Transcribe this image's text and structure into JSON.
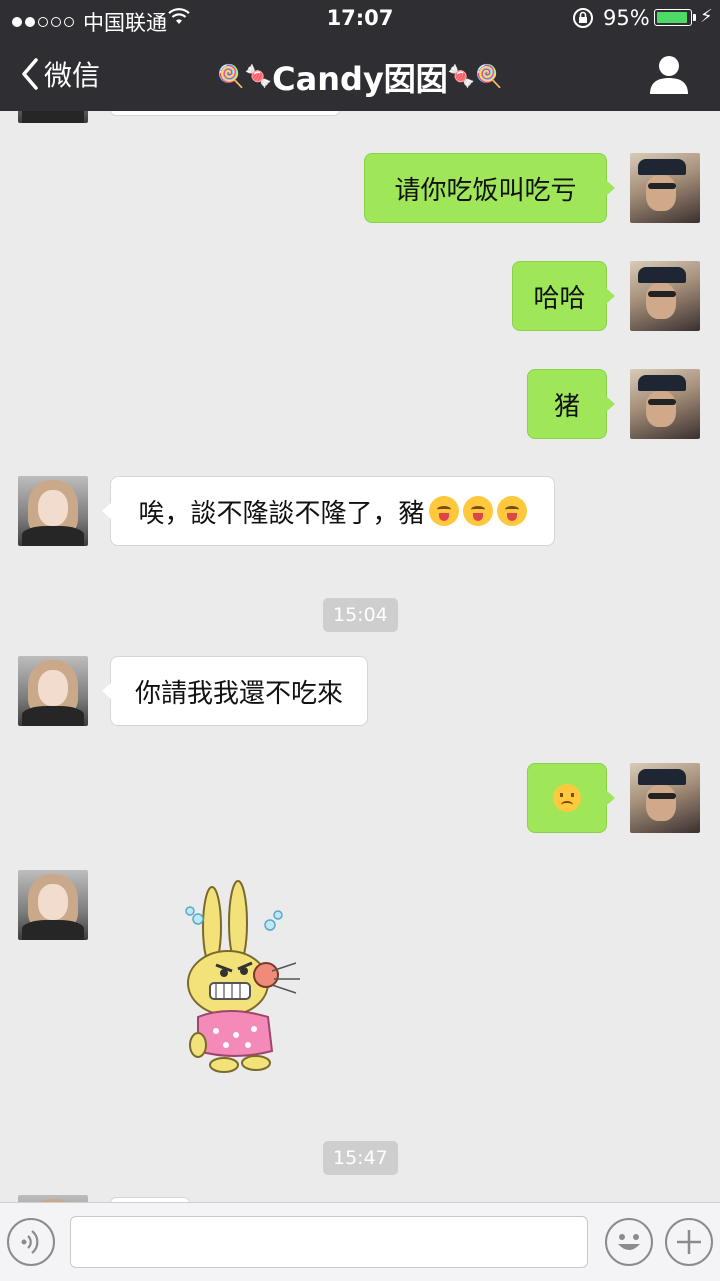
{
  "status_bar": {
    "carrier": "中国联通",
    "time": "17:07",
    "battery_percent": "95%",
    "battery_level": 0.95
  },
  "nav": {
    "back_label": "微信",
    "title": "Candy囡囡",
    "title_deco_left": "🍭🍬",
    "title_deco_right": "🍬🍭"
  },
  "messages": [
    {
      "from": "me",
      "text": "请你吃饭叫吃亏"
    },
    {
      "from": "me",
      "text": "哈哈"
    },
    {
      "from": "me",
      "text": "猪"
    },
    {
      "from": "other",
      "text": "唉，談不隆談不隆了，豬",
      "emoji": "tongue-out-emoji"
    },
    {
      "type": "timestamp",
      "text": "15:04"
    },
    {
      "from": "other",
      "text": "你請我我還不吃來"
    },
    {
      "from": "me",
      "emoji": "frown-emoji"
    },
    {
      "from": "other",
      "sticker": "angry-rabbit-sticker"
    },
    {
      "type": "timestamp",
      "text": "15:47"
    }
  ],
  "input_bar": {
    "voice_icon": "voice-icon",
    "emoji_icon": "smiley-icon",
    "plus_icon": "plus-icon",
    "text_value": ""
  },
  "colors": {
    "header_bg": "#2f2f33",
    "chat_bg": "#ebebeb",
    "bubble_me": "#9fe659",
    "bubble_other": "#ffffff"
  }
}
